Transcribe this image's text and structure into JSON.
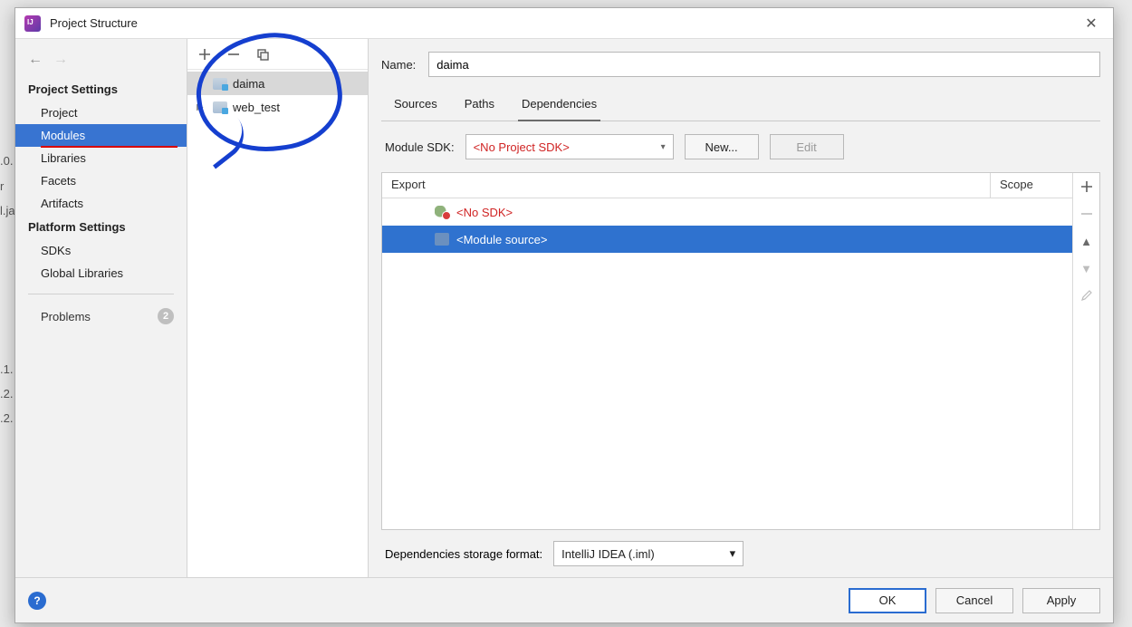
{
  "window": {
    "title": "Project Structure"
  },
  "sidebar": {
    "sections": {
      "project_settings": "Project Settings",
      "platform_settings": "Platform Settings"
    },
    "items": {
      "project": "Project",
      "modules": "Modules",
      "libraries": "Libraries",
      "facets": "Facets",
      "artifacts": "Artifacts",
      "sdks": "SDKs",
      "global_libraries": "Global Libraries",
      "problems": "Problems"
    },
    "problems_count": "2"
  },
  "tree": {
    "items": [
      {
        "label": "daima",
        "selected": true,
        "expandable": false
      },
      {
        "label": "web_test",
        "selected": false,
        "expandable": true
      }
    ]
  },
  "name_field": {
    "label": "Name:",
    "value": "daima"
  },
  "tabs": {
    "sources": "Sources",
    "paths": "Paths",
    "dependencies": "Dependencies"
  },
  "sdk": {
    "label": "Module SDK:",
    "selected": "<No Project SDK>",
    "new_btn": "New...",
    "edit_btn": "Edit"
  },
  "dep_table": {
    "col_export": "Export",
    "col_scope": "Scope",
    "rows": [
      {
        "label": "<No SDK>",
        "kind": "nosdk"
      },
      {
        "label": "<Module source>",
        "kind": "source",
        "selected": true
      }
    ]
  },
  "storage": {
    "label": "Dependencies storage format:",
    "value": "IntelliJ IDEA (.iml)"
  },
  "footer": {
    "ok": "OK",
    "cancel": "Cancel",
    "apply": "Apply"
  },
  "bg_strip": {
    "a": ".0.",
    "b": "r",
    "c": "l.ja",
    "d": ".1.",
    "e": ".2.",
    "f": ".2."
  }
}
